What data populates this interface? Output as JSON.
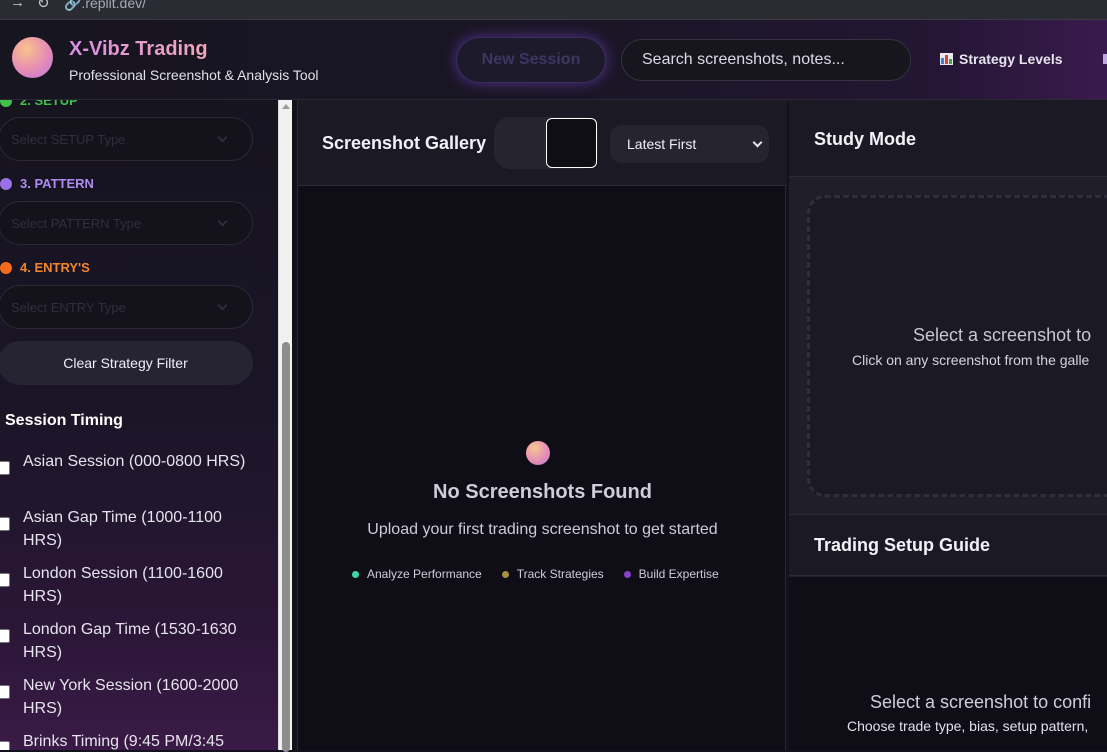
{
  "browser": {
    "back_glyph": "→",
    "reload_glyph": "↻",
    "url": "🔗.replit.dev/"
  },
  "header": {
    "title": "X-Vibz Trading",
    "subtitle": "Professional Screenshot & Analysis Tool",
    "new_session_label": "New Session",
    "search_placeholder": "Search screenshots, notes...",
    "strategy_levels_label": "Strategy Levels",
    "strategy_levels_icon": "bar-chart-icon"
  },
  "sidebar": {
    "sections": [
      {
        "label": "2. SETUP",
        "color": "#3fc24a",
        "placeholder": "Select SETUP Type"
      },
      {
        "label": "3. PATTERN",
        "color": "#9b6fe8",
        "placeholder": "Select PATTERN Type"
      },
      {
        "label": "4. ENTRY'S",
        "color": "#f26b1d",
        "placeholder": "Select ENTRY Type"
      }
    ],
    "clear_filter_label": "Clear Strategy Filter",
    "session_timing_heading": "Session Timing",
    "sessions": [
      "Asian Session (000-0800 HRS)",
      "Asian Gap Time (1000-1100 HRS)",
      "London Session (1100-1600 HRS)",
      "London Gap Time (1530-1630 HRS)",
      "New York Session (1600-2000 HRS)",
      "Brinks Timing (9:45 PM/3:45"
    ]
  },
  "gallery": {
    "title": "Screenshot Gallery",
    "sort_value": "Latest First",
    "empty_title": "No Screenshots Found",
    "empty_subtitle": "Upload your first trading screenshot to get started",
    "features": [
      {
        "label": "Analyze Performance",
        "color": "#3ed7a4"
      },
      {
        "label": "Track Strategies",
        "color": "#a89040"
      },
      {
        "label": "Build Expertise",
        "color": "#8a3fc8"
      }
    ]
  },
  "study": {
    "title": "Study Mode",
    "drop_title": "Select a screenshot to",
    "drop_subtitle": "Click on any screenshot from the galle",
    "guide_title": "Trading Setup Guide",
    "guide_prompt": "Select a screenshot to confi",
    "guide_subprompt": "Choose trade type, bias, setup pattern,"
  },
  "colors": {
    "accent_purple": "#7e46dc",
    "background": "#12111c"
  }
}
